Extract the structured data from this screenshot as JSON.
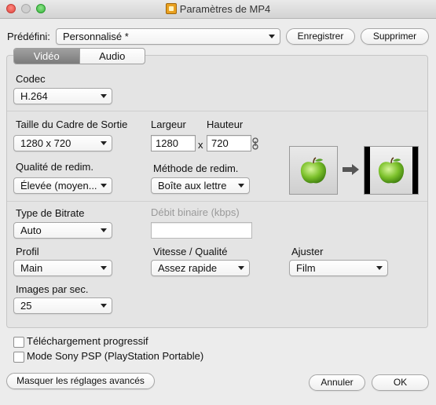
{
  "window": {
    "title": "Paramètres de MP4"
  },
  "header": {
    "preset_label": "Prédéfini:",
    "preset_value": "Personnalisé *",
    "save_label": "Enregistrer",
    "delete_label": "Supprimer"
  },
  "tabs": [
    {
      "label": "Vidéo",
      "active": true
    },
    {
      "label": "Audio",
      "active": false
    }
  ],
  "video": {
    "codec_label": "Codec",
    "codec_value": "H.264",
    "frame_size_label": "Taille du Cadre de Sortie",
    "frame_size_value": "1280 x 720",
    "width_label": "Largeur",
    "width_value": "1280",
    "times": "x",
    "height_label": "Hauteur",
    "height_value": "720",
    "resize_quality_label": "Qualité de redim.",
    "resize_quality_value": "Élevée (moyen...",
    "resize_method_label": "Méthode de redim.",
    "resize_method_value": "Boîte aux lettre",
    "bitrate_type_label": "Type de Bitrate",
    "bitrate_type_value": "Auto",
    "bitrate_label": "Débit binaire (kbps)",
    "bitrate_value": "",
    "profile_label": "Profil",
    "profile_value": "Main",
    "speed_quality_label": "Vitesse / Qualité",
    "speed_quality_value": "Assez rapide",
    "adjust_label": "Ajuster",
    "adjust_value": "Film",
    "fps_label": "Images par sec.",
    "fps_value": "25"
  },
  "options": {
    "progressive_label": "Téléchargement progressif",
    "progressive_checked": false,
    "sony_psp_label": "Mode Sony PSP (PlayStation Portable)",
    "sony_psp_checked": false
  },
  "footer": {
    "hide_advanced_label": "Masquer les réglages avancés",
    "cancel_label": "Annuler",
    "ok_label": "OK"
  },
  "colors": {
    "apple_green": "#7cc12b",
    "tab_active": "#8c8c8c"
  }
}
